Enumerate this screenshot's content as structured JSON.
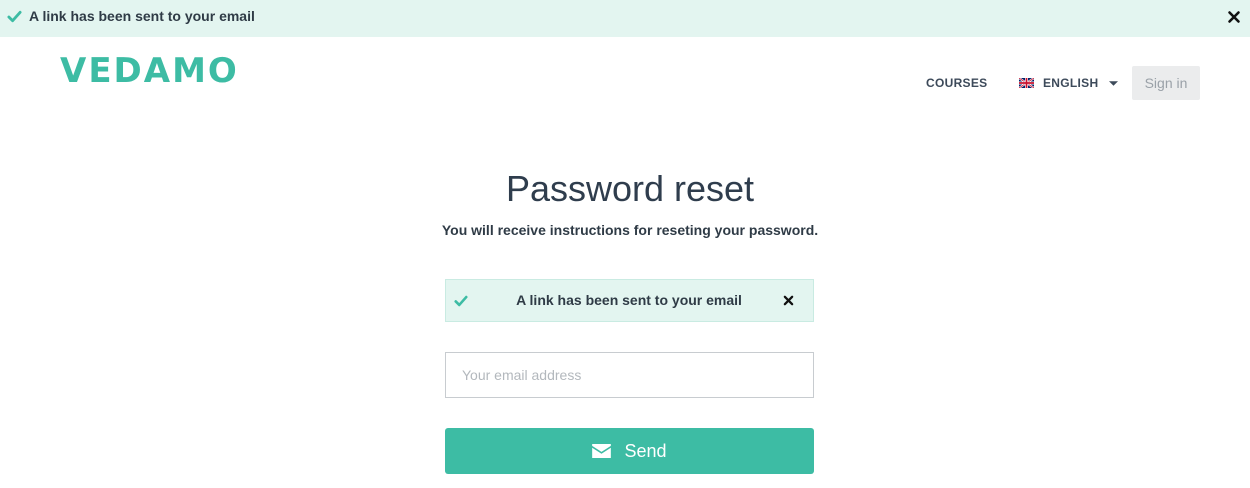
{
  "top_notification": {
    "message": "A link has been sent to your email",
    "icon": "check-icon",
    "close_icon": "close-icon"
  },
  "header": {
    "logo_text": "VEDAMO",
    "nav": {
      "courses_label": "COURSES",
      "language_label": "ENGLISH",
      "language_flag": "uk-flag-icon",
      "signin_label": "Sign in"
    }
  },
  "main": {
    "title": "Password reset",
    "subtitle": "You will receive instructions for reseting your password.",
    "alert": {
      "message": "A link has been sent to your email",
      "icon": "check-icon",
      "close_icon": "close-icon"
    },
    "email_field": {
      "placeholder": "Your email address",
      "value": ""
    },
    "send_button": {
      "label": "Send",
      "icon": "envelope-icon"
    }
  },
  "colors": {
    "brand": "#3dbca4",
    "alert_background": "#e3f5f0",
    "text_dark": "#2f3b46",
    "signin_background": "#ebeced"
  }
}
